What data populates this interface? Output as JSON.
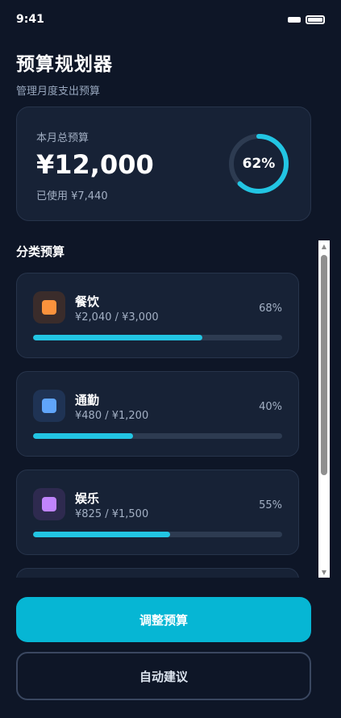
{
  "status_bar": {
    "time": "9:41"
  },
  "header": {
    "title": "预算规划器",
    "subtitle": "管理月度支出预算"
  },
  "summary": {
    "label": "本月总预算",
    "amount": "¥12,000",
    "used": "已使用 ¥7,440",
    "percent_text": "62%",
    "percent_value": 62
  },
  "categories_section": {
    "title": "分类预算"
  },
  "categories": [
    {
      "name": "餐饮",
      "amount": "¥2,040 / ¥3,000",
      "percent_text": "68%",
      "percent_value": 68,
      "icon": "dining-icon",
      "icon_color": "#fb923c",
      "icon_bg": "#3a2c2b"
    },
    {
      "name": "通勤",
      "amount": "¥480 / ¥1,200",
      "percent_text": "40%",
      "percent_value": 40,
      "icon": "commute-icon",
      "icon_color": "#60a5fa",
      "icon_bg": "#1f3354"
    },
    {
      "name": "娱乐",
      "amount": "¥825 / ¥1,500",
      "percent_text": "55%",
      "percent_value": 55,
      "icon": "entertainment-icon",
      "icon_color": "#c084fc",
      "icon_bg": "#2e2a4f"
    }
  ],
  "actions": {
    "primary_label": "调整预算",
    "secondary_label": "自动建议"
  },
  "colors": {
    "accent": "#22c5e3",
    "button_primary": "#06b6d4",
    "background": "#0e1627",
    "card": "#172236"
  }
}
